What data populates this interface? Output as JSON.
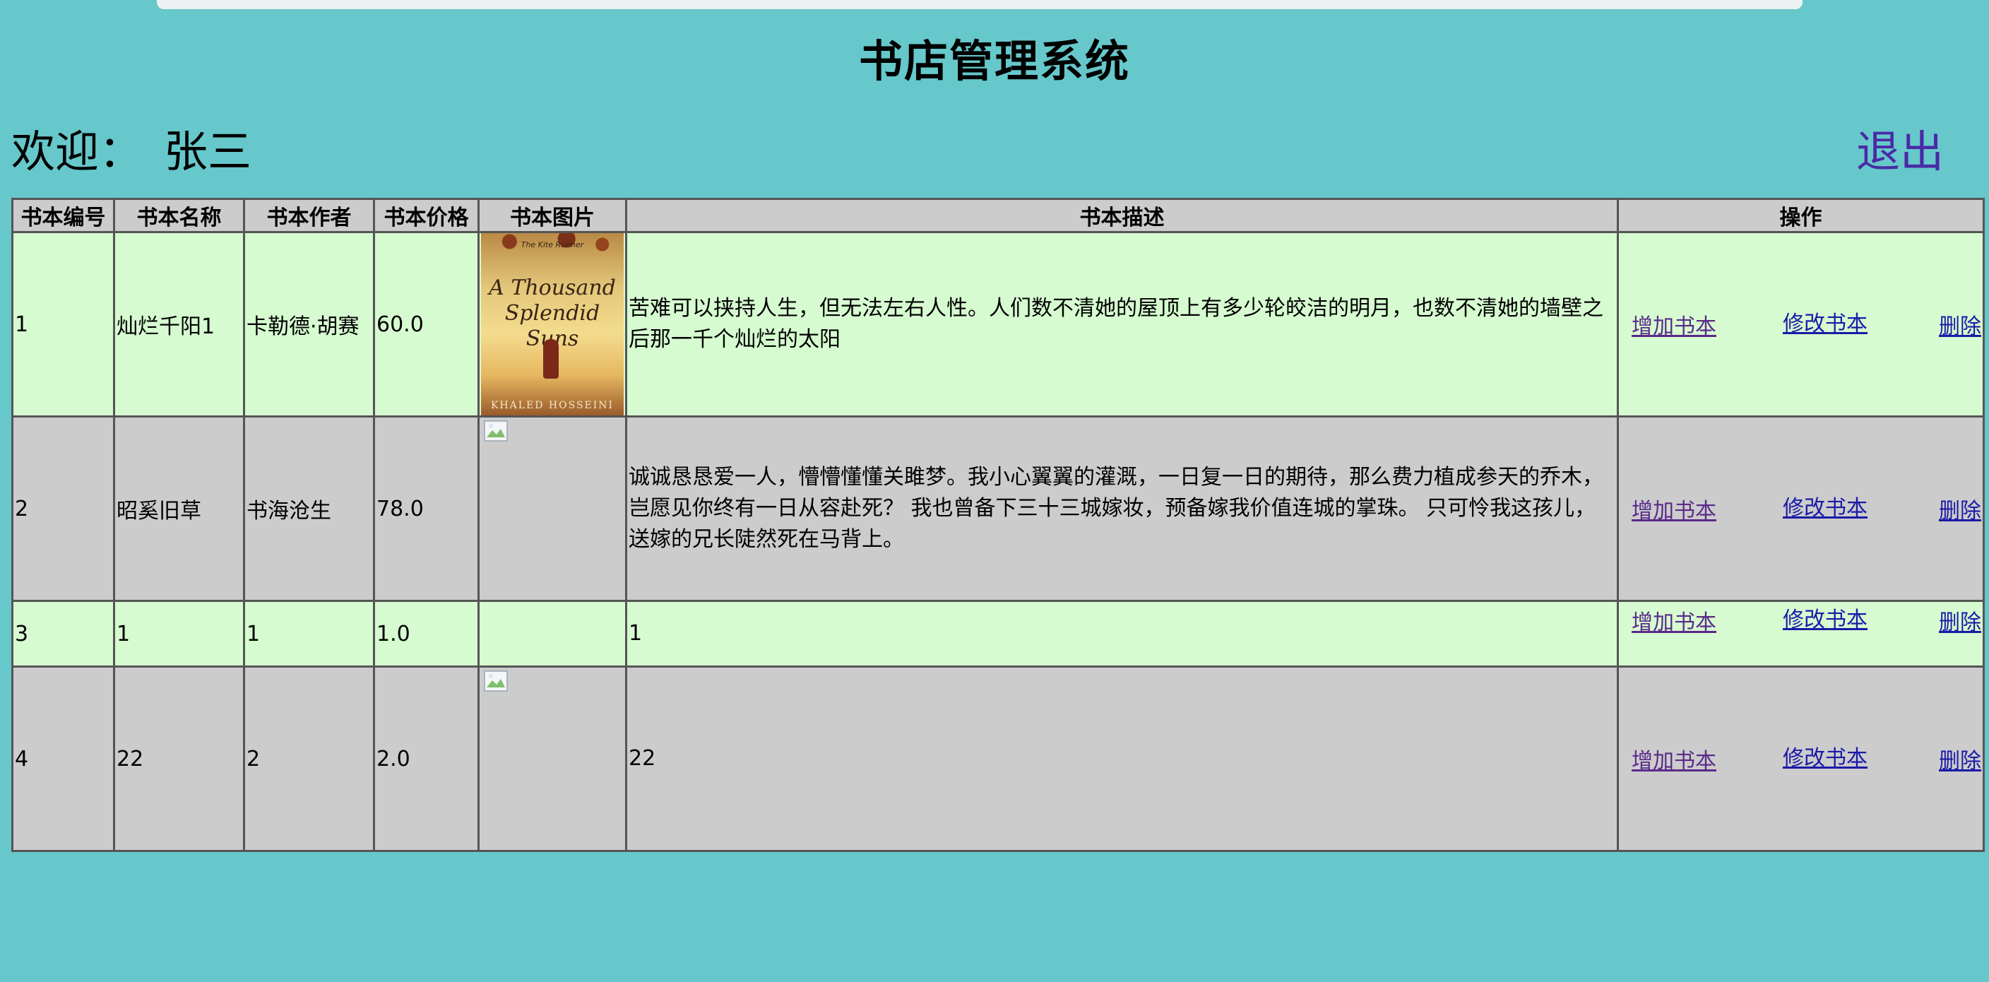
{
  "header": {
    "title": "书店管理系统",
    "welcome_label": "欢迎：",
    "username": "张三",
    "logout_label": "退出"
  },
  "table": {
    "columns": [
      "书本编号",
      "书本名称",
      "书本作者",
      "书本价格",
      "书本图片",
      "书本描述",
      "操作"
    ],
    "rows": [
      {
        "id": "1",
        "name": "灿烂千阳1",
        "author": "卡勒德·胡赛",
        "price": "60.0",
        "image": "book-cover-a-thousand-splendid-suns",
        "description": "苦难可以挟持人生，但无法左右人性。人们数不清她的屋顶上有多少轮皎洁的明月，也数不清她的墙壁之后那一千个灿烂的太阳"
      },
      {
        "id": "2",
        "name": "昭奚旧草",
        "author": "书海沧生",
        "price": "78.0",
        "image": "broken-image-icon",
        "description": "诚诚恳恳爱一人，懵懵懂懂关雎梦。我小心翼翼的灌溉，一日复一日的期待，那么费力植成参天的乔木，岂愿见你终有一日从容赴死？ 我也曾备下三十三城嫁妆，预备嫁我价值连城的掌珠。 只可怜我这孩儿，送嫁的兄长陡然死在马背上。"
      },
      {
        "id": "3",
        "name": "1",
        "author": "1",
        "price": "1.0",
        "image": "",
        "description": "1"
      },
      {
        "id": "4",
        "name": "22",
        "author": "2",
        "price": "2.0",
        "image": "broken-image-icon",
        "description": "22"
      }
    ],
    "actions": {
      "add": "增加书本",
      "edit": "修改书本",
      "delete": "删除"
    }
  },
  "cover": {
    "tagline": "The Kite Runner",
    "title_line1": "A Thousand",
    "title_line2": "Splendid Suns",
    "author": "KHALED HOSSEINI"
  },
  "colors": {
    "background": "#66c8cb",
    "row_light": "#d6fbd0",
    "row_gray": "#cccccc",
    "link": "#1a1aa8",
    "visited_link": "#5a2a8a"
  }
}
